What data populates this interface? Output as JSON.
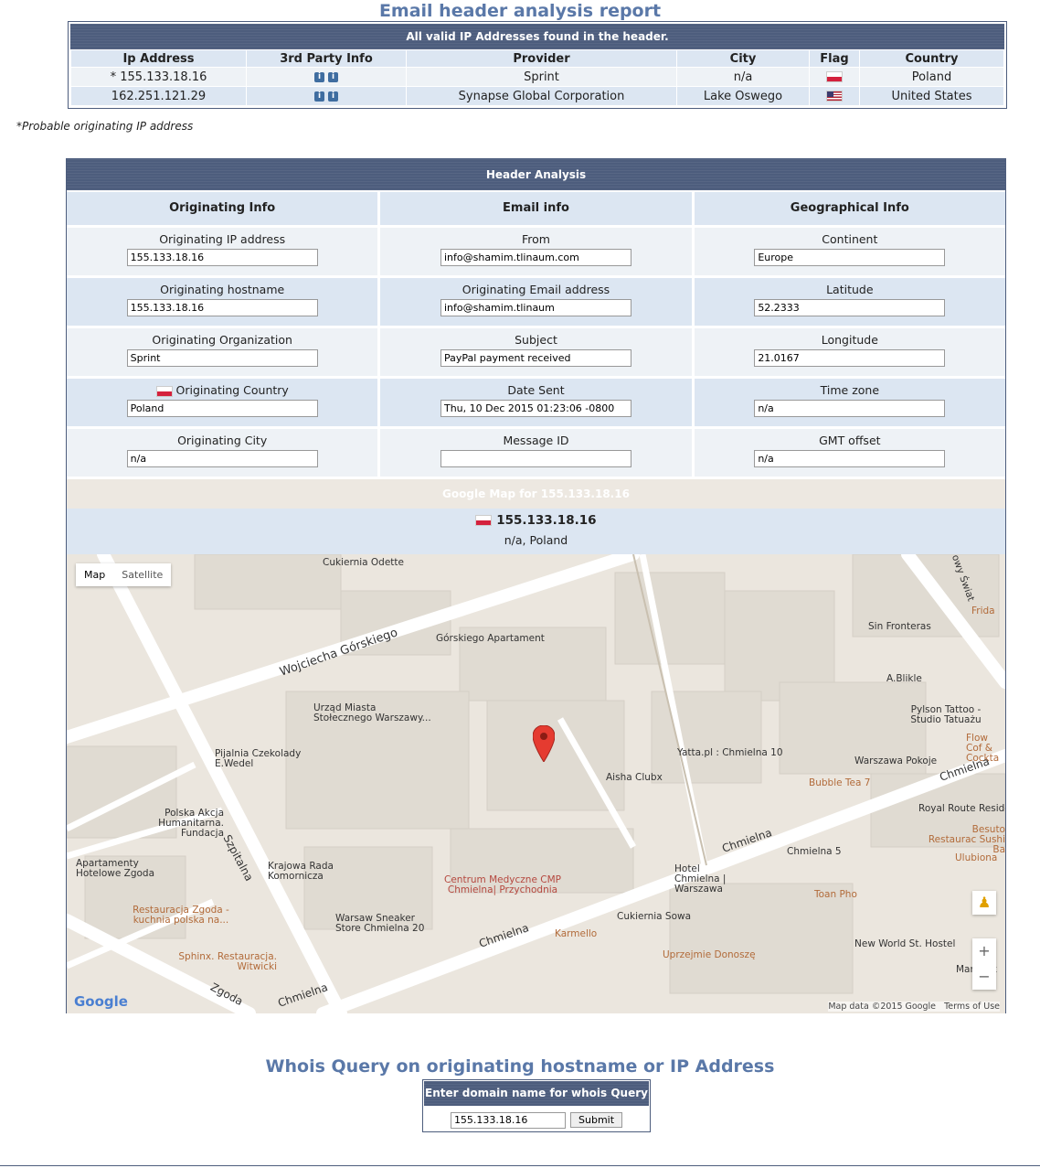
{
  "report_title": "Email header analysis report",
  "ip_table": {
    "header": "All valid IP Addresses found in the header.",
    "columns": [
      "Ip Address",
      "3rd Party Info",
      "Provider",
      "City",
      "Flag",
      "Country"
    ],
    "rows": [
      {
        "ip": "* 155.133.18.16",
        "provider": "Sprint",
        "city": "n/a",
        "flag": "pl-flag-icon",
        "country": "Poland"
      },
      {
        "ip": "162.251.121.29",
        "provider": "Synapse Global Corporation",
        "city": "Lake Oswego",
        "flag": "us-flag-icon",
        "country": "United States"
      }
    ],
    "info_icon": "i"
  },
  "footnote": "Probable originating IP address",
  "footnote_marker": "*",
  "analysis": {
    "header": "Header Analysis",
    "originating": {
      "title": "Originating Info",
      "fields": [
        {
          "label": "Originating IP address",
          "value": "155.133.18.16"
        },
        {
          "label": "Originating hostname",
          "value": "155.133.18.16"
        },
        {
          "label": "Originating Organization",
          "value": "Sprint"
        },
        {
          "label": "Originating Country",
          "value": "Poland"
        },
        {
          "label": "Originating City",
          "value": "n/a"
        }
      ]
    },
    "email": {
      "title": "Email info",
      "fields": [
        {
          "label": "From",
          "value": "info@shamim.tlinaum.com"
        },
        {
          "label": "Originating Email address",
          "value": "info@shamim.tlinaum"
        },
        {
          "label": "Subject",
          "value": "PayPal payment received"
        },
        {
          "label": "Date Sent",
          "value": "Thu, 10 Dec 2015 01:23:06 -0800"
        },
        {
          "label": "Message ID",
          "value": ""
        }
      ]
    },
    "geo": {
      "title": "Geographical Info",
      "fields": [
        {
          "label": "Continent",
          "value": "Europe"
        },
        {
          "label": "Latitude",
          "value": "52.2333"
        },
        {
          "label": "Longitude",
          "value": "21.0167"
        },
        {
          "label": "Time zone",
          "value": "n/a"
        },
        {
          "label": "GMT offset",
          "value": "n/a"
        }
      ]
    }
  },
  "map": {
    "header": "Google Map for 155.133.18.16",
    "ip": "155.133.18.16",
    "location": "n/a, Poland",
    "map_button": "Map",
    "satellite_button": "Satellite",
    "zoom_in": "+",
    "zoom_out": "−",
    "attribution": "Map data ©2015 Google",
    "terms": "Terms of Use",
    "logo": "Google",
    "labels": {
      "l1": "Cukiernia Odette",
      "l2": "Wojciecha Górskiego",
      "l3": "Górskiego Apartament",
      "l4": "Urząd Miasta Stołecznego Warszawy...",
      "l5": "Pijalnia Czekolady E.Wedel",
      "l6": "Yatta.pl : Chmielna 10",
      "l7": "Aisha Clubx",
      "l8": "Warszawa Pokoje",
      "l9": "Bubble Tea 7",
      "l10": "Polska Akcja Humanitarna. Fundacja",
      "l11": "Apartamenty Hotelowe Zgoda",
      "l12": "Szpitalna",
      "l13": "Krajowa Rada Komornicza",
      "l14": "Centrum Medyczne CMP Chmielna| Przychodnia",
      "l15": "Chmielna",
      "l16": "Hotel Chmielna | Warszawa",
      "l17": "Chmielna 5",
      "l18": "Toan Pho",
      "l19": "Restauracja Zgoda - kuchnia polska na...",
      "l20": "Sphinx. Restauracja. Witwicki",
      "l21": "Warsaw Sneaker Store Chmielna 20",
      "l22": "Karmello",
      "l23": "Cukiernia Sowa",
      "l24": "Uprzejmie Donoszę",
      "l25": "New World St. Hostel",
      "l26": "Zgoda",
      "l27": "Sin Fronteras",
      "l28": "A.Blikle",
      "l29": "Pylson Tattoo - Studio Tatuażu",
      "l30": "Royal Route Reside",
      "l31": "Besuto Restaurac Sushi Ba",
      "l32": "Ulubiona",
      "l33": "Frida",
      "l34": "Flow Cof & Cockta",
      "l35": "Manufak",
      "l36": "owy Świat",
      "l37": "Chmielna",
      "l38": "Chmielna",
      "l39": "Chmielna"
    }
  },
  "whois": {
    "title": "Whois Query on originating hostname or IP Address",
    "header": "Enter domain name for whois Query",
    "input_value": "155.133.18.16",
    "submit": "Submit"
  }
}
